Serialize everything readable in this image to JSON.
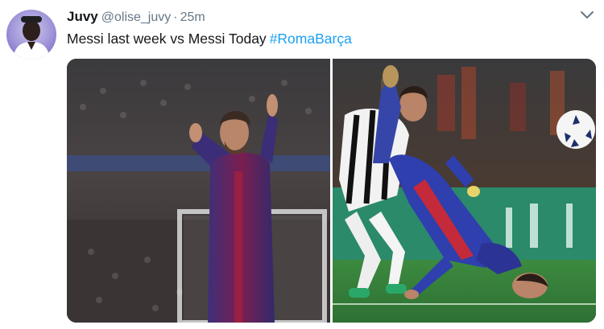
{
  "tweet": {
    "author_name": "Juvy",
    "author_handle": "@olise_juvy",
    "separator": "·",
    "timestamp": "25m",
    "text": "Messi last week vs Messi Today",
    "hashtag": "#RomaBarça"
  },
  "icons": {
    "menu": "chevron-down-icon",
    "avatar": "avatar-image"
  },
  "media": {
    "images": [
      {
        "id": "left",
        "subject": "player-arms-raised"
      },
      {
        "id": "right",
        "subject": "player-falling"
      }
    ]
  },
  "colors": {
    "hashtag": "#1da1f2",
    "secondary_text": "#657786",
    "primary_text": "#14171a"
  }
}
